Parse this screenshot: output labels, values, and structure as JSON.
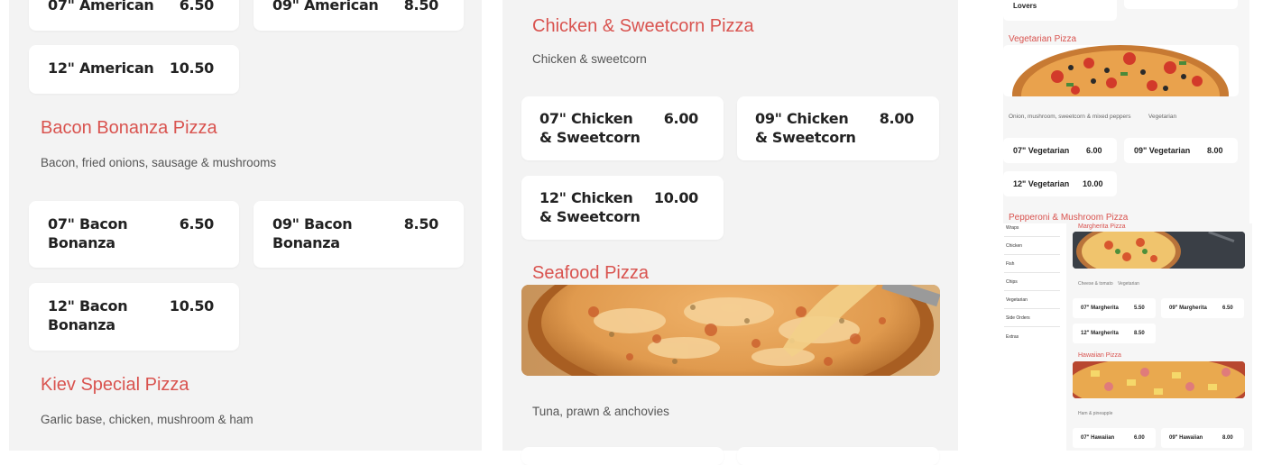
{
  "left_column": {
    "top_cards": [
      {
        "name": "07\" American",
        "price": "6.50"
      },
      {
        "name": "09\" American",
        "price": "8.50"
      },
      {
        "name": "12\" American",
        "price": "10.50"
      }
    ],
    "bacon": {
      "title": "Bacon Bonanza Pizza",
      "description": "Bacon, fried onions, sausage & mushrooms",
      "cards": [
        {
          "name": "07\" Bacon Bonanza",
          "price": "6.50"
        },
        {
          "name": "09\" Bacon Bonanza",
          "price": "8.50"
        },
        {
          "name": "12\" Bacon Bonanza",
          "price": "10.50"
        }
      ]
    },
    "kiev": {
      "title": "Kiev Special Pizza",
      "description": "Garlic base, chicken, mushroom & ham"
    }
  },
  "middle_column": {
    "chicken": {
      "title": "Chicken & Sweetcorn Pizza",
      "description": "Chicken & sweetcorn",
      "cards": [
        {
          "name": "07\" Chicken & Sweetcorn",
          "price": "6.00"
        },
        {
          "name": "09\" Chicken & Sweetcorn",
          "price": "8.00"
        },
        {
          "name": "12\" Chicken & Sweetcorn",
          "price": "10.00"
        }
      ]
    },
    "seafood": {
      "title": "Seafood Pizza",
      "description": "Tuna, prawn & anchovies"
    }
  },
  "right_column": {
    "lovers_label": "Lovers",
    "vegetarian": {
      "title": "Vegetarian Pizza",
      "description": "Onion, mushroom, sweetcorn & mixed peppers",
      "tag": "Vegetarian",
      "cards": [
        {
          "name": "07\" Vegetarian",
          "price": "6.00"
        },
        {
          "name": "09\" Vegetarian",
          "price": "8.00"
        },
        {
          "name": "12\" Vegetarian",
          "price": "10.00"
        }
      ]
    },
    "pepperoni_title": "Pepperoni & Mushroom Pizza",
    "nested": {
      "sidebar": [
        "Wraps",
        "Chicken",
        "Fish",
        "Chips",
        "Vegetarian",
        "Side Orders",
        "Extras"
      ],
      "margherita": {
        "title": "Margherita Pizza",
        "description": "Cheese & tomato",
        "tag": "Vegetarian",
        "cards": [
          {
            "name": "07\" Margherita",
            "price": "5.50"
          },
          {
            "name": "09\" Margherita",
            "price": "6.50"
          },
          {
            "name": "12\" Margherita",
            "price": "8.50"
          }
        ]
      },
      "hawaiian": {
        "title": "Hawaiian Pizza",
        "description": "Ham & pineapple",
        "cards": [
          {
            "name": "07\" Hawaiian",
            "price": "6.00"
          },
          {
            "name": "09\" Hawaiian",
            "price": "8.00"
          }
        ]
      }
    }
  },
  "colors": {
    "accent": "#d9534f",
    "panel": "#f3f3f3",
    "card": "#ffffff"
  }
}
